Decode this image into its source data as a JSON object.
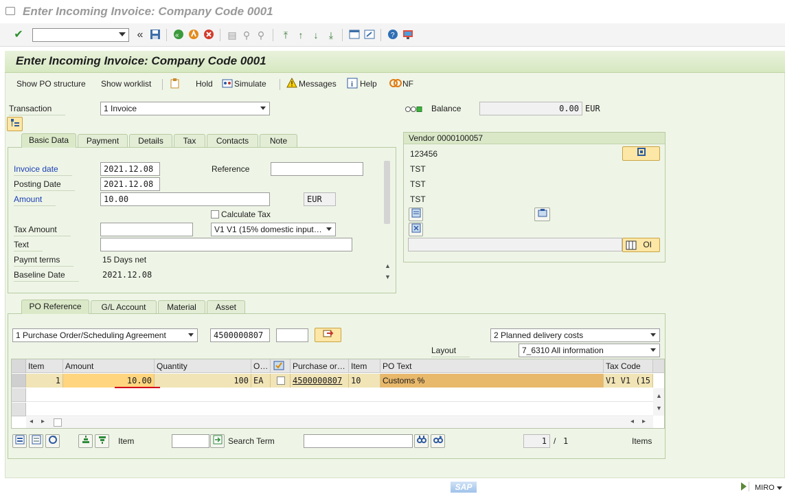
{
  "window": {
    "title": "Enter Incoming Invoice: Company Code 0001"
  },
  "toolbar": {
    "command_value": "",
    "icons": [
      "enter-check-icon",
      "save-icon",
      "back-icon",
      "exit-icon",
      "cancel-icon",
      "print-icon",
      "find-icon",
      "find-next-icon",
      "first-page-icon",
      "prev-page-icon",
      "next-page-icon",
      "last-page-icon",
      "new-session-icon",
      "shortcut-icon",
      "help-icon",
      "customize-layout-icon"
    ],
    "nav_glyph": "«"
  },
  "page": {
    "title": "Enter Incoming Invoice: Company Code 0001"
  },
  "app_toolbar": {
    "show_po_structure": "Show PO structure",
    "show_worklist": "Show worklist",
    "hold": "Hold",
    "simulate": "Simulate",
    "messages": "Messages",
    "help": "Help",
    "nf": "NF"
  },
  "header": {
    "transaction_label": "Transaction",
    "transaction_value": "1 Invoice",
    "balance_label": "Balance",
    "balance_value": "0.00",
    "balance_currency": "EUR"
  },
  "basic_tabs": [
    "Basic Data",
    "Payment",
    "Details",
    "Tax",
    "Contacts",
    "Note"
  ],
  "basic": {
    "invoice_date_label": "Invoice date",
    "invoice_date": "2021.12.08",
    "reference_label": "Reference",
    "reference": "",
    "posting_date_label": "Posting Date",
    "posting_date": "2021.12.08",
    "amount_label": "Amount",
    "amount": "10.00",
    "currency": "EUR",
    "calculate_tax_label": "Calculate Tax",
    "tax_amount_label": "Tax Amount",
    "tax_amount": "",
    "tax_code": "V1 V1 (15% domestic input…",
    "text_label": "Text",
    "text": "",
    "paymt_terms_label": "Paymt terms",
    "paymt_terms": "15 Days net",
    "baseline_label": "Baseline Date",
    "baseline": "2021.12.08"
  },
  "vendor": {
    "title": "Vendor 0000100057",
    "lines": [
      "123456",
      "TST",
      "TST",
      "TST"
    ],
    "oi_label": "OI"
  },
  "po_tabs": [
    "PO Reference",
    "G/L Account",
    "Material",
    "Asset"
  ],
  "po": {
    "ref_type": "1 Purchase Order/Scheduling Agreement",
    "po_number": "4500000807",
    "po_item": "",
    "delivery_costs": "2 Planned delivery costs",
    "layout_label": "Layout",
    "layout": "7_6310 All information"
  },
  "table": {
    "headers": [
      "Item",
      "Amount",
      "Quantity",
      "O…",
      "Purchase or…",
      "Item",
      "PO Text",
      "Tax Code"
    ],
    "rows": [
      {
        "item": "1",
        "amount": "10.00",
        "quantity": "100",
        "order_unit": "EA",
        "po": "4500000807",
        "po_item": "10",
        "po_text": "Customs %",
        "tax_code": "V1 V1 (15"
      }
    ]
  },
  "footer": {
    "item_label": "Item",
    "item_value": "",
    "search_term_label": "Search Term",
    "search_term": "",
    "page_current": "1",
    "page_sep": "/",
    "page_total": "1",
    "items_label": "Items"
  },
  "statusbar": {
    "logo": "SAP",
    "tcode": "MIRO"
  },
  "colors": {
    "accent_row": "#ffd57f",
    "panel": "#eef5e6",
    "header": "#d6e8c1",
    "underline": "#d4001a"
  }
}
